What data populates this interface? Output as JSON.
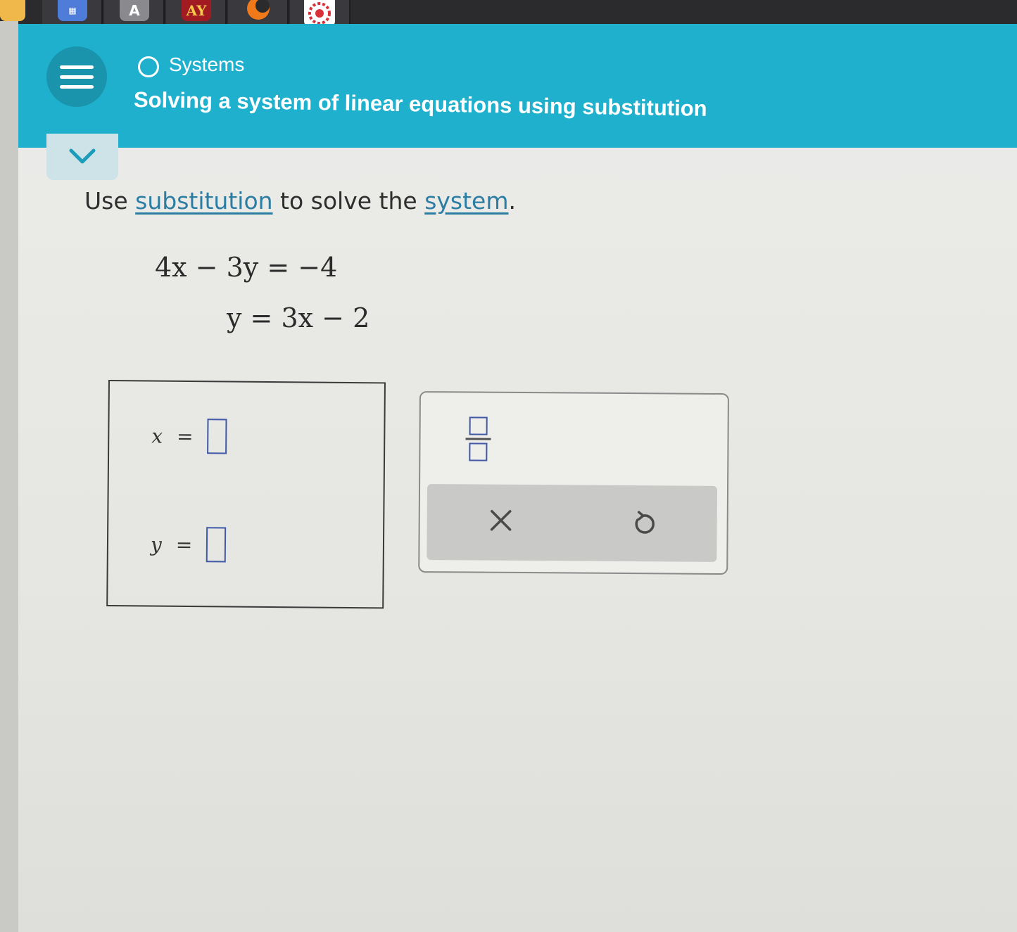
{
  "browser": {
    "bookmarks": [
      {
        "name": "bookmark-icon-1",
        "label": "",
        "color": "#f0b74a"
      },
      {
        "name": "bookmark-icon-2",
        "label": "",
        "color": "#4f7bd9"
      },
      {
        "name": "bookmark-icon-3",
        "label": "A",
        "color": "#8a8a8e"
      },
      {
        "name": "bookmark-icon-4",
        "label": "AY",
        "color": "#a31b22"
      },
      {
        "name": "bookmark-icon-5",
        "label": "",
        "color": "#f07a1a"
      },
      {
        "name": "bookmark-icon-6",
        "label": "",
        "color": "#d8313a"
      }
    ]
  },
  "header": {
    "topic": "Systems",
    "title": "Solving a system of linear equations using substitution",
    "accent_color": "#1fb0cd"
  },
  "instruction": {
    "prefix": "Use ",
    "link1": "substitution",
    "middle": " to solve the ",
    "link2": "system",
    "suffix": "."
  },
  "equations": {
    "eq1": "4x − 3y = −4",
    "eq2": "y = 3x − 2"
  },
  "answer": {
    "x_label": "x",
    "y_label": "y",
    "equals": "=",
    "x_value": "",
    "y_value": ""
  },
  "keypad": {
    "fraction_icon": "fraction-template-icon",
    "clear_icon": "close-icon",
    "undo_icon": "undo-icon"
  }
}
